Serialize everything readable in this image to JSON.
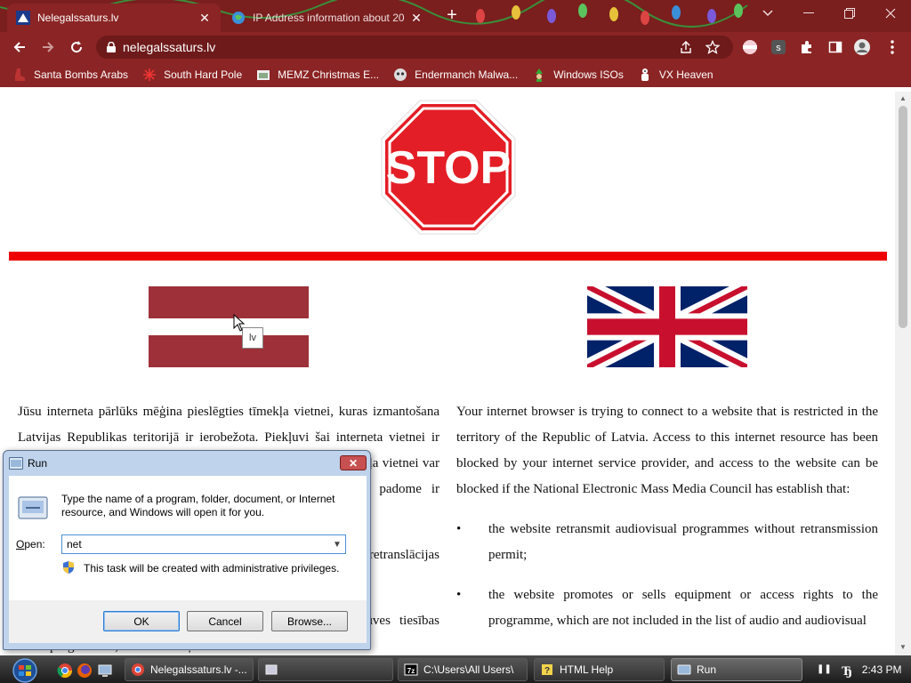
{
  "browser": {
    "tabs": [
      {
        "title": "Nelegalssaturs.lv",
        "active": true
      },
      {
        "title": "IP Address information about 20",
        "active": false
      }
    ],
    "url": "nelegalssaturs.lv",
    "bookmarks": [
      {
        "label": "Santa Bombs Arabs",
        "icon": "boot-icon"
      },
      {
        "label": "South Hard Pole",
        "icon": "snowflake-icon"
      },
      {
        "label": "MEMZ Christmas E...",
        "icon": "gift-icon"
      },
      {
        "label": "Endermanch Malwa...",
        "icon": "skull-icon"
      },
      {
        "label": "Windows ISOs",
        "icon": "elf-icon"
      },
      {
        "label": "VX Heaven",
        "icon": "gingerbread-icon"
      }
    ]
  },
  "page": {
    "stop_sign_text": "STOP",
    "lv_flag_tooltip": "lv",
    "lv_text": {
      "p1": "Jūsu interneta pārlūks mēģina pieslēgties tīmekļa vietnei, kuras izmantošana Latvijas Republikas teritorijā ir ierobežota. Piekļuvi šai interneta vietnei ir bloķējis Jūsu interneta pakalpojumu sniedzējs, un piekļuve tīmekļa vietnei var tikt bloķēta, ja Nacionālā elektronisko plašsaziņas līdzekļu padome ir konstatējusi, ka:",
      "b1": "tīmekļa vietne retranslē audiovizuālās programmas bez retranslācijas atļaujas;",
      "b2": "tīmekļa vietne reklamē vai pārdod iekārtas vai piekļuves tiesības programmai, kura nav iekļauta audio un"
    },
    "en_text": {
      "p1": "Your internet browser is trying to connect to a website that is restricted in the territory of the Republic of Latvia. Access to this internet resource has been blocked by your internet service provider, and access to the website can be blocked if the National Electronic Mass Media Council has establish that:",
      "b1": "the website retransmit audiovisual programmes without retransmission permit;",
      "b2": "the website promotes or sells equipment or access rights to the programme, which are not included in the list of audio and audiovisual"
    },
    "bullet_char": "•"
  },
  "run_dialog": {
    "title": "Run",
    "description": "Type the name of a program, folder, document, or Internet resource, and Windows will open it for you.",
    "open_label_accel": "O",
    "open_label_rest": "pen:",
    "input_value": "net",
    "admin_note": "This task will be created with administrative privileges.",
    "ok_label": "OK",
    "cancel_label": "Cancel",
    "browse_label": "Browse..."
  },
  "taskbar": {
    "items": [
      {
        "label": "Nelegalssaturs.lv -...",
        "icon": "chrome-icon"
      },
      {
        "label": "",
        "icon": "window-icon"
      },
      {
        "label": "C:\\Users\\All Users\\",
        "icon": "sevenzip-icon"
      },
      {
        "label": "HTML Help",
        "icon": "help-icon"
      },
      {
        "label": "Run",
        "icon": "run-icon"
      }
    ],
    "time": "2:43 PM"
  },
  "colors": {
    "chrome_dark": "#7a1e1e",
    "chrome": "#8b2424",
    "stop_red": "#e41e26",
    "lv_carmine": "#9e3039",
    "uk_blue": "#012169",
    "uk_red": "#c8102e",
    "divider_red": "#ee0000"
  }
}
